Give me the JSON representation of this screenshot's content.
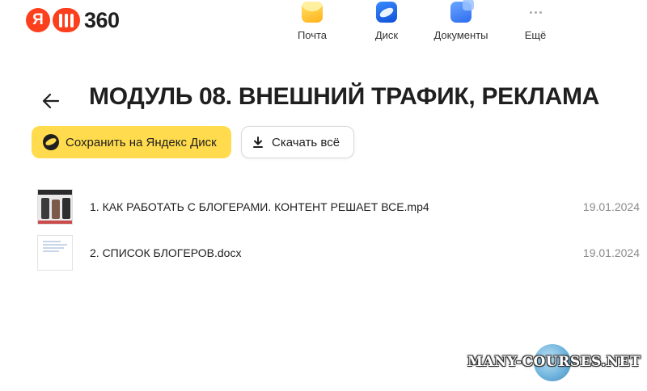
{
  "brand": {
    "ya": "Я",
    "text": "360"
  },
  "apps": [
    {
      "label": "Почта",
      "icon": "mail-icon"
    },
    {
      "label": "Диск",
      "icon": "disk-icon"
    },
    {
      "label": "Документы",
      "icon": "documents-icon"
    },
    {
      "label": "Ещё",
      "icon": "more-icon"
    }
  ],
  "page": {
    "title": "МОДУЛЬ 08. ВНЕШНИЙ ТРАФИК, РЕКЛАМА"
  },
  "actions": {
    "save_label": "Сохранить на Яндекс Диск",
    "download_label": "Скачать всё"
  },
  "files": [
    {
      "name": "1. КАК РАБОТАТЬ С БЛОГЕРАМИ. КОНТЕНТ РЕШАЕТ ВСЕ.mp4",
      "date": "19.01.2024",
      "type": "video"
    },
    {
      "name": "2. СПИСОК БЛОГЕРОВ.docx",
      "date": "19.01.2024",
      "type": "document"
    }
  ],
  "watermark": "MANY-COURSES.NET",
  "colors": {
    "accent": "#ffdb4d",
    "brand_red": "#fc3f1d",
    "disk_blue": "#0e4fd6"
  }
}
